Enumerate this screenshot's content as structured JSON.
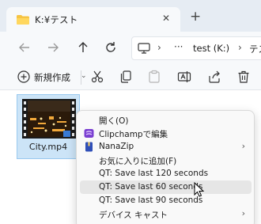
{
  "tab": {
    "title": "K:¥テスト",
    "close": "✕"
  },
  "new_tab": "+",
  "address": {
    "ellipsis": "···",
    "crumb1": "test (K:)",
    "crumb2": "テス"
  },
  "toolbar": {
    "new_label": "新規作成",
    "dropdown": "⌄"
  },
  "file": {
    "name": "City.mp4"
  },
  "menu": {
    "items": [
      {
        "label": "開く(O)",
        "submenu": false
      },
      {
        "label": "Clipchampで編集",
        "submenu": false
      },
      {
        "label": "NanaZip",
        "submenu": true
      },
      {
        "label": "お気に入りに追加(F)",
        "submenu": false
      },
      {
        "label": "QT: Save last 120 seconds",
        "submenu": false
      },
      {
        "label": "QT: Save last 60 seconds",
        "submenu": false,
        "highlighted": true
      },
      {
        "label": "QT: Save last 90 seconds",
        "submenu": false
      },
      {
        "label": "デバイス キャスト",
        "submenu": true
      }
    ],
    "submenu_arrow": "›"
  },
  "colors": {
    "accent": "#0067c0",
    "selection_bg": "#cce4f7",
    "menu_hover": "#e6e6e6"
  }
}
